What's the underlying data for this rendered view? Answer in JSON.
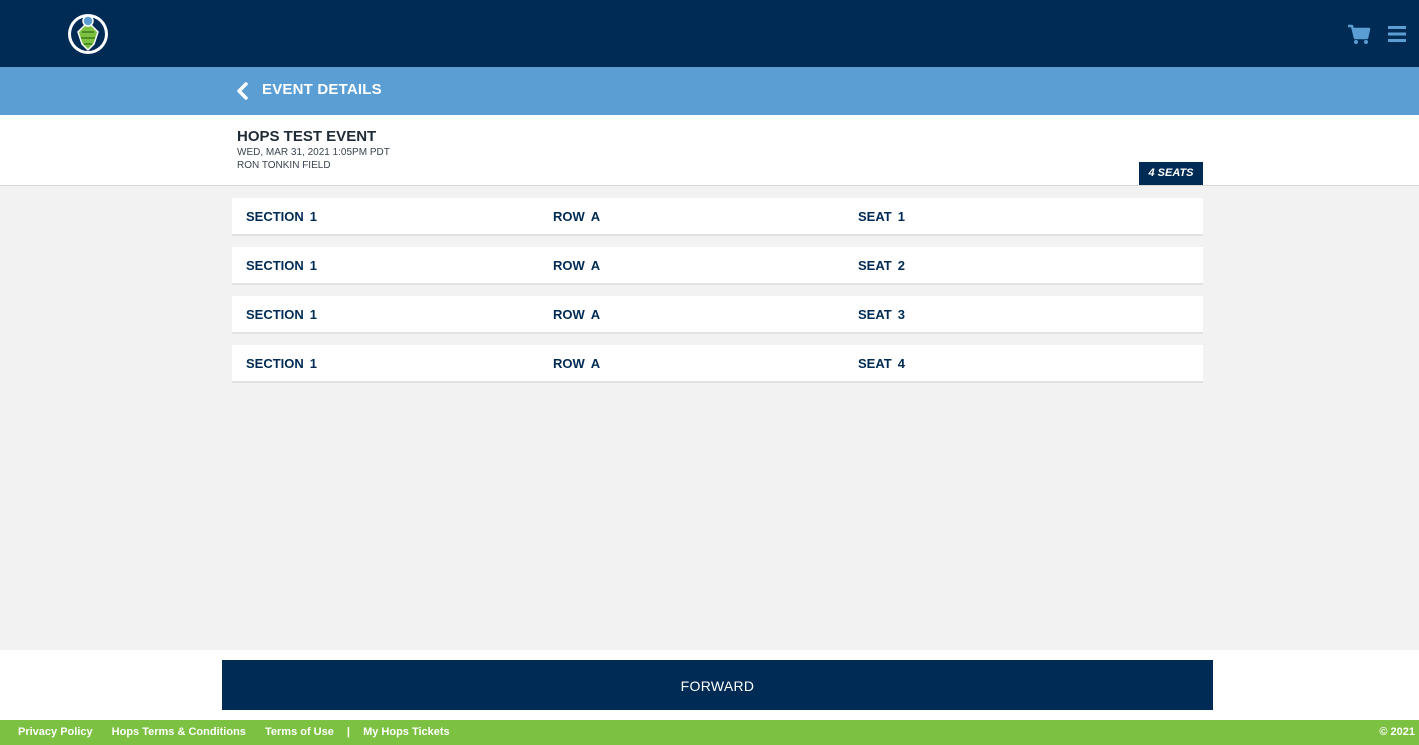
{
  "header": {
    "logo_icon": "hops-mascot-logo",
    "cart_icon": "cart-icon",
    "menu_icon": "hamburger-menu-icon",
    "colors": {
      "nav": "#002b54",
      "subbar": "#5a9ed3",
      "footer": "#7cc142"
    }
  },
  "subheader": {
    "back_icon": "chevron-left-icon",
    "title": "EVENT DETAILS"
  },
  "event": {
    "name": "HOPS TEST EVENT",
    "date": "WED, MAR 31, 2021 1:05PM PDT",
    "venue": "RON TONKIN FIELD",
    "seats_badge": "4 SEATS"
  },
  "tickets": [
    {
      "section_label": "SECTION",
      "section": "1",
      "row_label": "ROW",
      "row": "A",
      "seat_label": "SEAT",
      "seat": "1"
    },
    {
      "section_label": "SECTION",
      "section": "1",
      "row_label": "ROW",
      "row": "A",
      "seat_label": "SEAT",
      "seat": "2"
    },
    {
      "section_label": "SECTION",
      "section": "1",
      "row_label": "ROW",
      "row": "A",
      "seat_label": "SEAT",
      "seat": "3"
    },
    {
      "section_label": "SECTION",
      "section": "1",
      "row_label": "ROW",
      "row": "A",
      "seat_label": "SEAT",
      "seat": "4"
    }
  ],
  "actions": {
    "forward_label": "FORWARD"
  },
  "footer": {
    "privacy": "Privacy Policy",
    "hops_terms": "Hops Terms & Conditions",
    "terms_of_use": "Terms of Use",
    "separator": "|",
    "my_tickets": "My Hops Tickets",
    "copyright": "© 2021"
  }
}
